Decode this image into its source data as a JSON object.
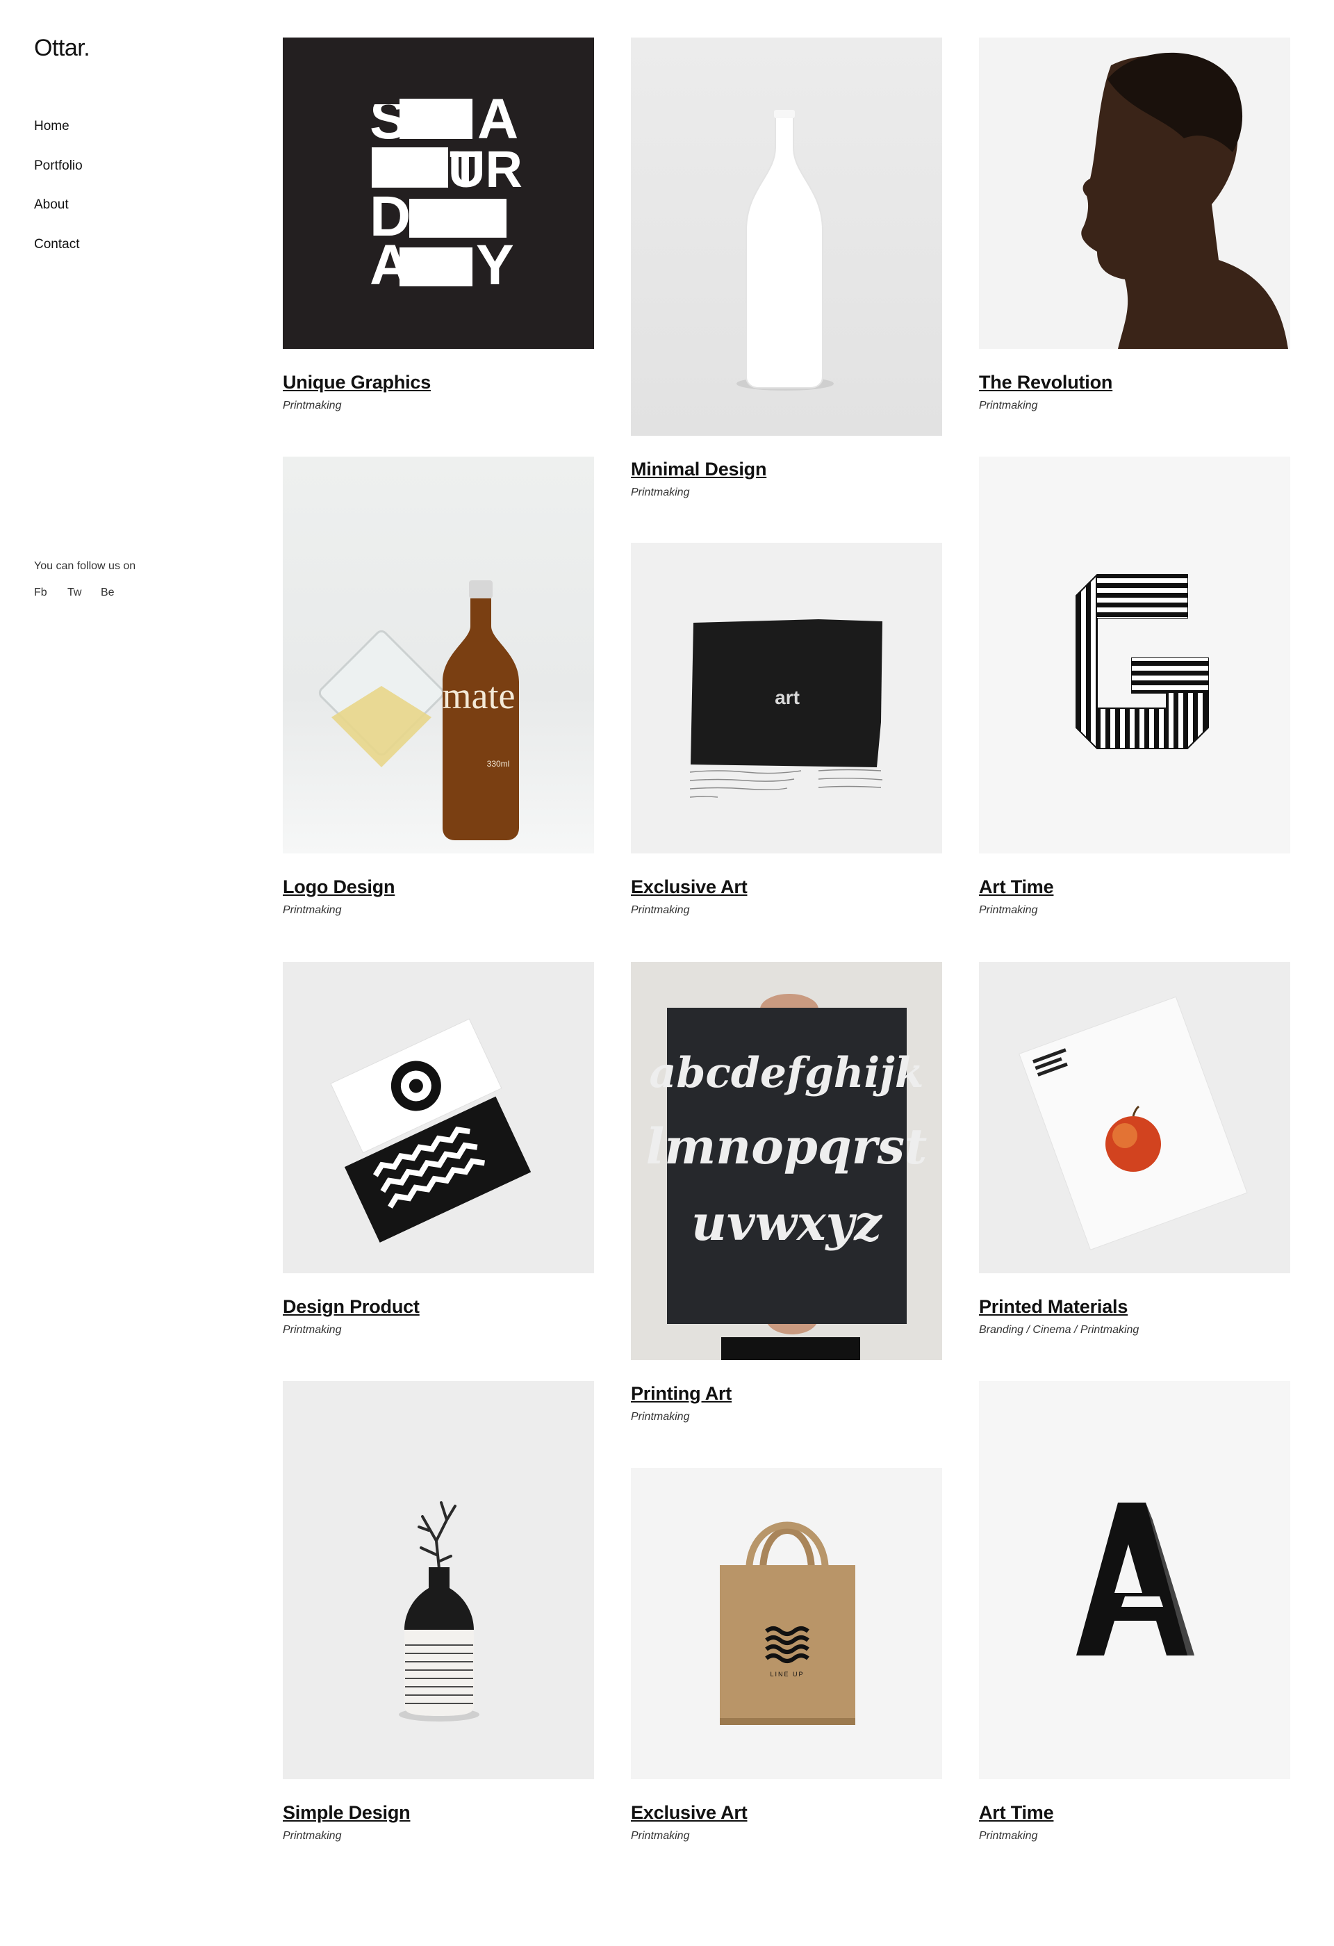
{
  "site": {
    "logo": "Ottar."
  },
  "nav": {
    "items": [
      "Home",
      "Portfolio",
      "About",
      "Contact"
    ]
  },
  "social": {
    "follow_text": "You can follow us on",
    "links": [
      "Fb",
      "Tw",
      "Be"
    ]
  },
  "portfolio": {
    "items": [
      {
        "title": "Unique Graphics",
        "category": "Printmaking",
        "image": "saturday-typography-poster",
        "art": {
          "letters": [
            "S",
            "A",
            "T",
            "UR",
            "D",
            "A",
            "Y"
          ]
        }
      },
      {
        "title": "Minimal Design",
        "category": "Printmaking",
        "image": "white-bottle"
      },
      {
        "title": "The Revolution",
        "category": "Printmaking",
        "image": "profile-portrait"
      },
      {
        "title": "Logo Design",
        "category": "Printmaking",
        "image": "glass-and-bottle",
        "art": {
          "label": "mate",
          "volume": "330ml"
        }
      },
      {
        "title": "Exclusive Art",
        "category": "Printmaking",
        "image": "black-print-art",
        "art": {
          "label": "art"
        }
      },
      {
        "title": "Art Time",
        "category": "Printmaking",
        "image": "striped-letter-g",
        "art": {
          "letter": "G"
        }
      },
      {
        "title": "Design Product",
        "category": "Printmaking",
        "image": "business-cards"
      },
      {
        "title": "Printing Art",
        "category": "Printmaking",
        "image": "alphabet-poster",
        "art": {
          "lines": [
            "abcdefghijk",
            "lmnopqrst",
            "uvwxyz"
          ]
        }
      },
      {
        "title": "Printed Materials",
        "category": "Branding / Cinema / Printmaking",
        "image": "apple-print"
      },
      {
        "title": "Simple Design",
        "category": "Printmaking",
        "image": "striped-vase"
      },
      {
        "title": "Exclusive Art",
        "category": "Printmaking",
        "image": "tote-bag",
        "art": {
          "label": "LINE UP"
        }
      },
      {
        "title": "Art Time",
        "category": "Printmaking",
        "image": "letter-a-3d",
        "art": {
          "letter": "A"
        }
      }
    ]
  }
}
